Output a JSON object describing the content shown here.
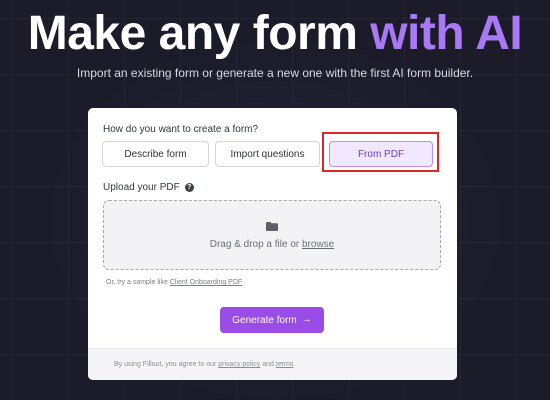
{
  "hero": {
    "title_main": "Make any form ",
    "title_accent": "with AI",
    "subtitle": "Import an existing form or generate a new one with the first AI form builder."
  },
  "form": {
    "question": "How do you want to create a form?",
    "options": [
      "Describe form",
      "Import questions",
      "From PDF"
    ],
    "selected_option": "From PDF",
    "upload_label": "Upload your PDF",
    "help_icon_glyph": "?",
    "drop_text": "Drag & drop a file or ",
    "browse_link": "browse",
    "sample_text": "Or, try a sample like ",
    "sample_link": "Client Onboarding PDF",
    "generate_button": "Generate form",
    "generate_arrow": "→"
  },
  "footer": {
    "legal_prefix": "By using Fillout, you agree to our ",
    "privacy_link": "privacy policy",
    "and_text": " and ",
    "terms_link": "terms",
    "end": "."
  },
  "colors": {
    "background": "#1b1b29",
    "accent": "#a978f5",
    "primary_button": "#9a4ce6",
    "selected_option_bg": "#f1e7fe",
    "highlight_box": "#d42a2a"
  },
  "icons": [
    "help-icon",
    "folder-icon",
    "arrow-right-icon"
  ]
}
